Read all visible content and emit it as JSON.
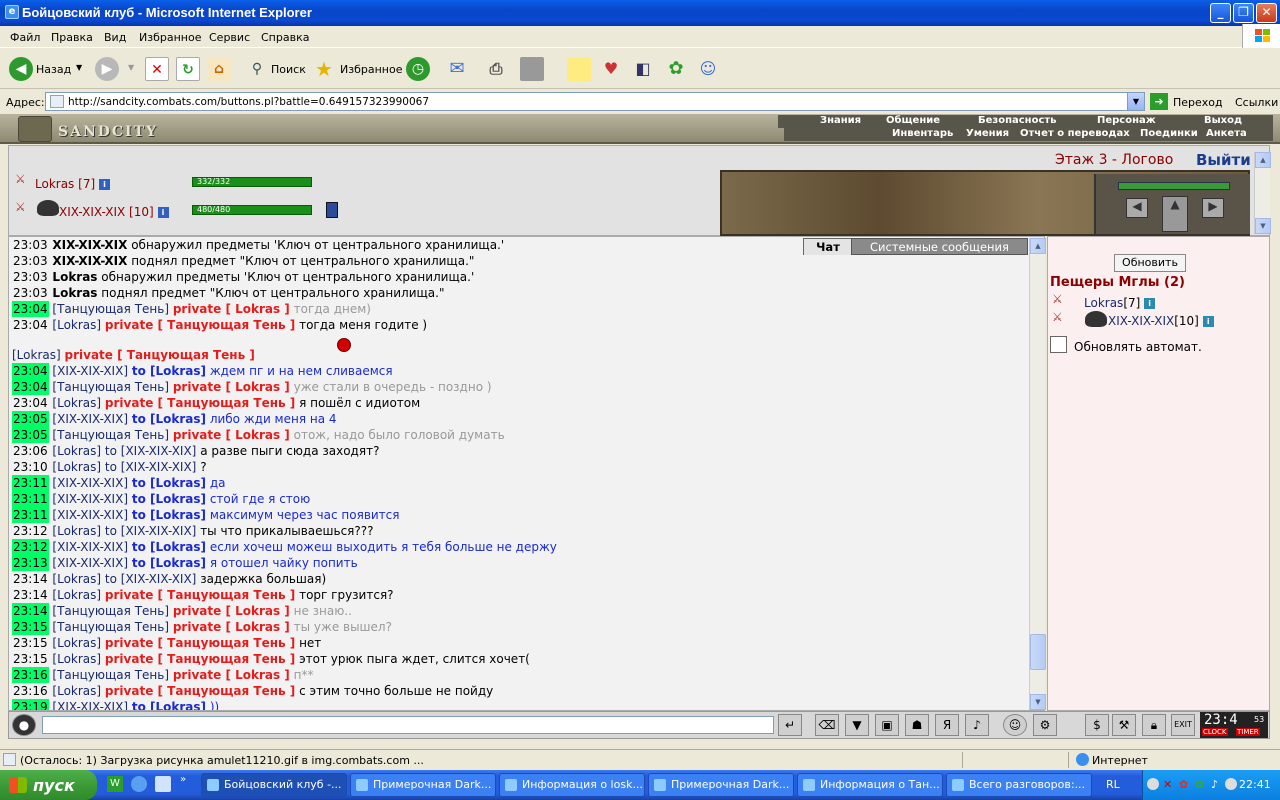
{
  "window": {
    "title": "Бойцовский клуб - Microsoft Internet Explorer"
  },
  "menu": [
    "Файл",
    "Правка",
    "Вид",
    "Избранное",
    "Сервис",
    "Справка"
  ],
  "toolbar": {
    "back": "Назад",
    "search": "Поиск",
    "favorites": "Избранное"
  },
  "address": {
    "label": "Адрес:",
    "url": "http://sandcity.combats.com/buttons.pl?battle=0.649157323990067",
    "go": "Переход",
    "links": "Ссылки"
  },
  "game": {
    "logo": "SANDCITY",
    "nav_top": [
      "Знания",
      "Общение",
      "Безопасность",
      "Персонаж",
      "Выход"
    ],
    "nav_bottom": [
      "Инвентарь",
      "Умения",
      "Отчет о переводах",
      "Поединки",
      "Анкета"
    ],
    "location": "Этаж 3 - Логово",
    "exit": "Выйти",
    "player1": {
      "name": "Lokras",
      "level": "[7]",
      "hp": "332/332"
    },
    "player2": {
      "name": "XIX-XIX-XIX",
      "level": "[10]",
      "hp": "480/480"
    }
  },
  "chat": {
    "tab_chat": "Чат",
    "tab_system": "Системные сообщения",
    "lines": [
      {
        "t": "23:03",
        "hl": false,
        "a": "XIX-XIX-XIX",
        "kind": "sys",
        "msg": "обнаружил предметы 'Ключ от центрального хранилища.'"
      },
      {
        "t": "23:03",
        "hl": false,
        "a": "XIX-XIX-XIX",
        "kind": "sys",
        "msg": "поднял предмет \"Ключ от центрального хранилища.\""
      },
      {
        "t": "23:03",
        "hl": false,
        "a": "Lokras",
        "kind": "sys",
        "msg": "обнаружил предметы 'Ключ от центрального хранилища.'"
      },
      {
        "t": "23:03",
        "hl": false,
        "a": "Lokras",
        "kind": "sys",
        "msg": "поднял предмет \"Ключ от центрального хранилища.\""
      },
      {
        "t": "23:04",
        "hl": true,
        "a": "[Танцующая Тень]",
        "kind": "priv",
        "to": "private [ Lokras ]",
        "msg": "тогда днем)",
        "mc": "gray"
      },
      {
        "t": "23:04",
        "hl": false,
        "a": "[Lokras]",
        "kind": "priv",
        "to": "private [ Танцующая Тень ]",
        "msg": "тогда меня годите )",
        "mc": ""
      },
      {
        "t": "23:04",
        "hl": false,
        "a": "[Lokras]",
        "kind": "priv",
        "to": "private [ Танцующая Тень ]",
        "msg": "",
        "mc": "",
        "gap": true
      },
      {
        "t": "23:04",
        "hl": true,
        "a": "[XIX-XIX-XIX]",
        "kind": "to",
        "to": "to [Lokras]",
        "msg": "ждем пг и на нем сливаемся",
        "mc": "blue"
      },
      {
        "t": "23:04",
        "hl": true,
        "a": "[Танцующая Тень]",
        "kind": "priv",
        "to": "private [ Lokras ]",
        "msg": "уже стали в очередь - поздно )",
        "mc": "gray"
      },
      {
        "t": "23:04",
        "hl": false,
        "a": "[Lokras]",
        "kind": "priv",
        "to": "private [ Танцующая Тень ]",
        "msg": "я пошёл с идиотом",
        "mc": ""
      },
      {
        "t": "23:05",
        "hl": true,
        "a": "[XIX-XIX-XIX]",
        "kind": "to",
        "to": "to [Lokras]",
        "msg": "либо жди меня на 4",
        "mc": "blue"
      },
      {
        "t": "23:05",
        "hl": true,
        "a": "[Танцующая Тень]",
        "kind": "priv",
        "to": "private [ Lokras ]",
        "msg": "отож, надо было головой думать",
        "mc": "gray"
      },
      {
        "t": "23:06",
        "hl": false,
        "a": "[Lokras]",
        "kind": "to2",
        "to": "to [XIX-XIX-XIX]",
        "msg": "а разве пыги сюда заходят?",
        "mc": ""
      },
      {
        "t": "23:10",
        "hl": false,
        "a": "[Lokras]",
        "kind": "to2",
        "to": "to [XIX-XIX-XIX]",
        "msg": "?",
        "mc": ""
      },
      {
        "t": "23:11",
        "hl": true,
        "a": "[XIX-XIX-XIX]",
        "kind": "to",
        "to": "to [Lokras]",
        "msg": "да",
        "mc": "blue"
      },
      {
        "t": "23:11",
        "hl": true,
        "a": "[XIX-XIX-XIX]",
        "kind": "to",
        "to": "to [Lokras]",
        "msg": "стой где я стою",
        "mc": "blue"
      },
      {
        "t": "23:11",
        "hl": true,
        "a": "[XIX-XIX-XIX]",
        "kind": "to",
        "to": "to [Lokras]",
        "msg": "максимум через час появится",
        "mc": "blue"
      },
      {
        "t": "23:12",
        "hl": false,
        "a": "[Lokras]",
        "kind": "to2",
        "to": "to [XIX-XIX-XIX]",
        "msg": "ты что прикалываешься???",
        "mc": ""
      },
      {
        "t": "23:12",
        "hl": true,
        "a": "[XIX-XIX-XIX]",
        "kind": "to",
        "to": "to [Lokras]",
        "msg": "если хочеш можеш выходить я тебя больше не держу",
        "mc": "blue"
      },
      {
        "t": "23:13",
        "hl": true,
        "a": "[XIX-XIX-XIX]",
        "kind": "to",
        "to": "to [Lokras]",
        "msg": "я отошел чайку попить",
        "mc": "blue"
      },
      {
        "t": "23:14",
        "hl": false,
        "a": "[Lokras]",
        "kind": "to2",
        "to": "to [XIX-XIX-XIX]",
        "msg": "задержка большая)",
        "mc": ""
      },
      {
        "t": "23:14",
        "hl": false,
        "a": "[Lokras]",
        "kind": "priv",
        "to": "private [ Танцующая Тень ]",
        "msg": "торг грузится?",
        "mc": ""
      },
      {
        "t": "23:14",
        "hl": true,
        "a": "[Танцующая Тень]",
        "kind": "priv",
        "to": "private [ Lokras ]",
        "msg": "не знаю..",
        "mc": "gray"
      },
      {
        "t": "23:15",
        "hl": true,
        "a": "[Танцующая Тень]",
        "kind": "priv",
        "to": "private [ Lokras ]",
        "msg": "ты уже вышел?",
        "mc": "gray"
      },
      {
        "t": "23:15",
        "hl": false,
        "a": "[Lokras]",
        "kind": "priv",
        "to": "private [ Танцующая Тень ]",
        "msg": "нет",
        "mc": ""
      },
      {
        "t": "23:15",
        "hl": false,
        "a": "[Lokras]",
        "kind": "priv",
        "to": "private [ Танцующая Тень ]",
        "msg": "этот урюк пыга ждет, слится хочет(",
        "mc": ""
      },
      {
        "t": "23:16",
        "hl": true,
        "a": "[Танцующая Тень]",
        "kind": "priv",
        "to": "private [ Lokras ]",
        "msg": "п**",
        "mc": "gray"
      },
      {
        "t": "23:16",
        "hl": false,
        "a": "[Lokras]",
        "kind": "priv",
        "to": "private [ Танцующая Тень ]",
        "msg": "с этим точно больше не пойду",
        "mc": ""
      },
      {
        "t": "23:19",
        "hl": true,
        "a": "[XIX-XIX-XIX]",
        "kind": "to",
        "to": "to [Lokras]",
        "msg": "))",
        "mc": "blue"
      }
    ]
  },
  "room": {
    "refresh": "Обновить",
    "title": "Пещеры Мглы (2)",
    "p1": {
      "name": "Lokras",
      "level": "[7]"
    },
    "p2": {
      "name": "XIX-XIX-XIX",
      "level": "[10]"
    },
    "auto": "Обновлять автомат."
  },
  "clock": {
    "time": "23:4",
    "sec": "53",
    "l1": "CLOCK",
    "l2": "TIMER"
  },
  "status": {
    "text": "(Осталось: 1) Загрузка рисунка amulet11210.gif в img.combats.com ...",
    "zone": "Интернет"
  },
  "taskbar": {
    "start": "пуск",
    "items": [
      "Бойцовский клуб -...",
      "Примерочная Dark...",
      "Информация о losk...",
      "Примерочная Dark...",
      "Информация о Тан...",
      "Всего разговоров:..."
    ],
    "lang": "RL",
    "time": "22:41"
  },
  "colors": {
    "highlight": "#00FF66",
    "private": "#e41c1c",
    "to": "#1a2ad0",
    "location": "#8b0000"
  }
}
